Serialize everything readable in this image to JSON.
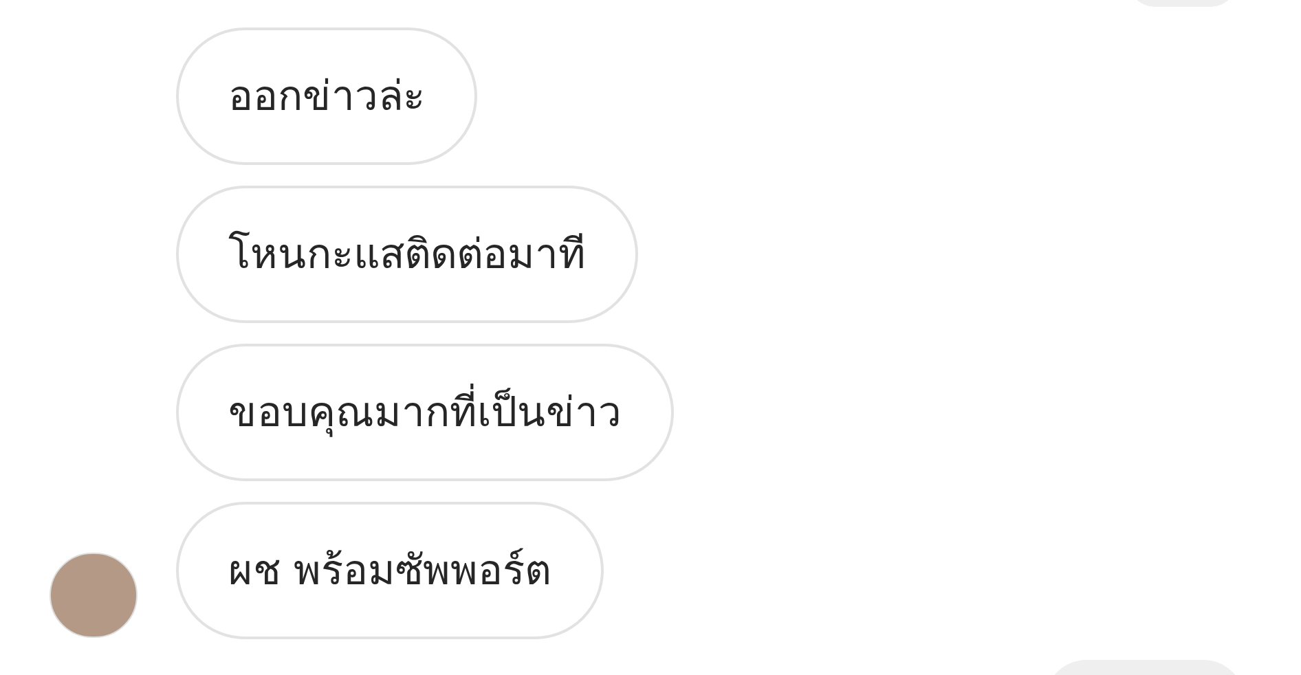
{
  "messages": [
    {
      "kind": "outgoing"
    },
    {
      "kind": "incoming",
      "text": "ออกข่าวล่ะ",
      "show_avatar": false
    },
    {
      "kind": "incoming",
      "text": "โหนกะแสติดต่อมาที",
      "show_avatar": false
    },
    {
      "kind": "incoming",
      "text": "ขอบคุณมากที่เป็นข่าว",
      "show_avatar": false
    },
    {
      "kind": "incoming",
      "text": "ผช พร้อมซัพพอร์ต",
      "show_avatar": true
    },
    {
      "kind": "outgoing"
    }
  ]
}
